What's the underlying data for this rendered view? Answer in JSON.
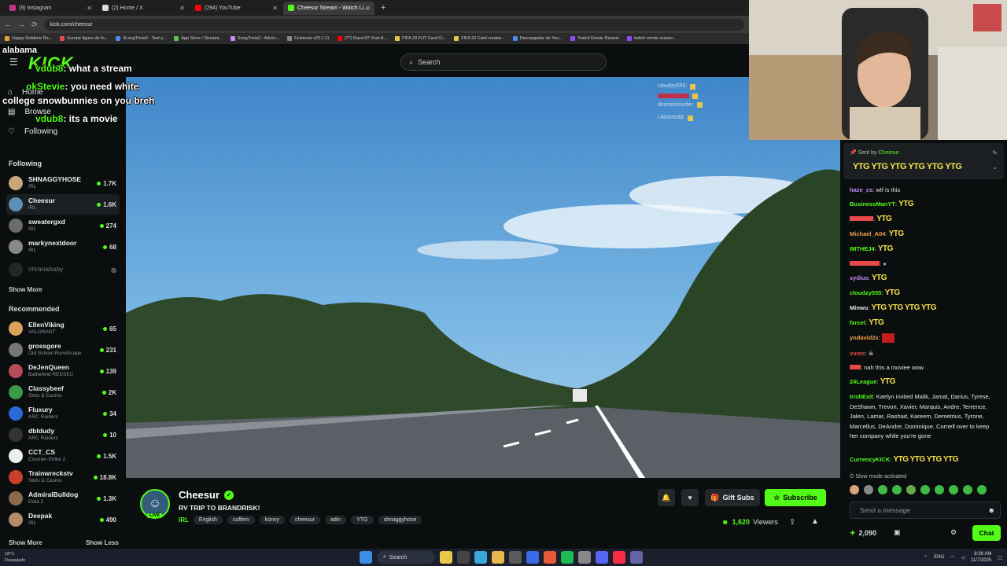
{
  "browser": {
    "tabs": [
      {
        "label": "(9) Instagram",
        "color": "#c13584",
        "active": false
      },
      {
        "label": "(2) Home / X",
        "color": "#dddddd",
        "active": false
      },
      {
        "label": "(294) YouTube",
        "color": "#ff0000",
        "active": false
      },
      {
        "label": "Cheesur Stream - Watch Li...",
        "color": "#53fc18",
        "active": true
      }
    ],
    "url": "kick.com/cheesur",
    "bookmarks": [
      "Happy Goldene Re...",
      "Europe ligues de fo...",
      "4LongTrivia2 - Test y...",
      "App Store / Streami...",
      "SongTrivia2 - Adivin...",
      "Feletools v25.1.11",
      "(77) Razor97 Zest-A...",
      "FIFA 23 FUT Card Cr...",
      "FIFA 23 Card creator...",
      "Descargador de You...",
      "Twitch Emote Resizer",
      "twitch emote resizer..."
    ]
  },
  "kick": {
    "logo": "KICK",
    "search_placeholder": "Search"
  },
  "overlay_chat": [
    {
      "user": "",
      "text": "alabama"
    },
    {
      "user": "vdub8",
      "text": ": what a stream"
    },
    {
      "user": "okStevie",
      "text": ": you need white"
    },
    {
      "user": "",
      "text": "college snowbunnies on you breh"
    },
    {
      "user": "vdub8",
      "text": ": its a movie"
    }
  ],
  "sidebar": {
    "nav": {
      "home": "Home",
      "browse": "Browse",
      "following": "Following"
    },
    "following_title": "Following",
    "following": [
      {
        "name": "SHNAGGYHOSE",
        "category": "IRL",
        "viewers": "1.7K",
        "color": "#c9a57a"
      },
      {
        "name": "Cheesur",
        "category": "IRL",
        "viewers": "1.6K",
        "color": "#5d8fb8"
      },
      {
        "name": "sweatergxd",
        "category": "IRL",
        "viewers": "274",
        "color": "#6b6b6b"
      },
      {
        "name": "markynextdoor",
        "category": "IRL",
        "viewers": "68",
        "color": "#888888"
      },
      {
        "name": "chranababy",
        "category": "",
        "viewers": "",
        "color": "#444444"
      }
    ],
    "show_more": "Show More",
    "recommended_title": "Recommended",
    "recommended": [
      {
        "name": "EllenViking",
        "category": "VALORANT",
        "viewers": "65",
        "color": "#d9a45a"
      },
      {
        "name": "grossgore",
        "category": "Old School RuneScape",
        "viewers": "231",
        "color": "#777777"
      },
      {
        "name": "DeJenQueen",
        "category": "Battlefield REDSEC",
        "viewers": "139",
        "color": "#b84a5a"
      },
      {
        "name": "Classybeef",
        "category": "Slots & Casino",
        "viewers": "2K",
        "color": "#3a9a4a"
      },
      {
        "name": "Fluxury",
        "category": "ARC Raiders",
        "viewers": "34",
        "color": "#2a6ad8"
      },
      {
        "name": "dbldudy",
        "category": "ARC Raiders",
        "viewers": "10",
        "color": "#333333"
      },
      {
        "name": "CCT_CS",
        "category": "Counter-Strike 2",
        "viewers": "1.5K",
        "color": "#eeeeee"
      },
      {
        "name": "Trainwreckstv",
        "category": "Slots & Casino",
        "viewers": "18.8K",
        "color": "#c8402a"
      },
      {
        "name": "AdmiralBulldog",
        "category": "Dota 2",
        "viewers": "1.3K",
        "color": "#8a6a4a"
      },
      {
        "name": "Deepak",
        "category": "IRL",
        "viewers": "490",
        "color": "#b58a6a"
      }
    ],
    "show_more_bottom": "Show More",
    "show_less": "Show Less"
  },
  "video_overlay_names": [
    "cloudzy555:",
    "",
    "demishimvrbn:",
    "I Abortedd:"
  ],
  "stream": {
    "streamer": "Cheesur",
    "live_label": "LIVE",
    "title": "RV TRIP TO BRANDRISK!",
    "category": "IRL",
    "tags": [
      "English",
      "cuffem",
      "konvy",
      "cheesur",
      "adin",
      "YTG",
      "shnaggyhose"
    ],
    "gift_subs": "Gift Subs",
    "subscribe": "Subscribe",
    "viewers": "1,620",
    "viewers_label": "Viewers"
  },
  "chat": {
    "pinned_label": "Sent by",
    "pinned_user": "Cheesur",
    "pinned_message": "YTG YTG YTG YTG YTG YTG",
    "messages": [
      {
        "user": "haze_cs",
        "color": "#c98bf7",
        "text": ": wtf is this",
        "emote": ""
      },
      {
        "user": "BusinessManYT",
        "color": "#53fc18",
        "text": ":",
        "emote": "YTG"
      },
      {
        "user": "",
        "color": "#e84a4a",
        "text": ":",
        "emote": "YTG"
      },
      {
        "user": "Michael_A04",
        "color": "#f0a04a",
        "text": ":",
        "emote": "YTG"
      },
      {
        "user": "IMTHEJ4",
        "color": "#53fc18",
        "text": ":",
        "emote": "YTG"
      },
      {
        "user": "",
        "color": "#e84a4a",
        "text": ":",
        "emote": ""
      },
      {
        "user": "sydius",
        "color": "#c98bf7",
        "text": ":",
        "emote": "YTG"
      },
      {
        "user": "cloudzy555",
        "color": "#53fc18",
        "text": ":",
        "emote": "YTG"
      },
      {
        "user": "Minwu",
        "color": "#e8e8e8",
        "text": ":",
        "emote": "YTG YTG YTG YTG"
      },
      {
        "user": "fxrcel",
        "color": "#53fc18",
        "text": ":",
        "emote": "YTG"
      },
      {
        "user": "yndavid2x",
        "color": "#f0a04a",
        "text": ":",
        "emote": ""
      },
      {
        "user": "vums",
        "color": "#e84a4a",
        "text": ":",
        "emote": ""
      },
      {
        "user": "",
        "color": "#e84a4a",
        "text": ": nah this a moviee wow",
        "emote": ""
      },
      {
        "user": "24League",
        "color": "#53fc18",
        "text": ":",
        "emote": "YTG"
      },
      {
        "user": "IrishExit",
        "color": "#53fc18",
        "text": ": Kaelyn invited Malik, Jamal, Darius, Tyrese, DeShawn, Trevon, Xavier, Marquis, Andre, Terrence, Jalen, Lamar, Rashad, Kareem, Demetrius, Tyrone, Marcellus, DeAndre, Dominique, Cornell over to keep her company while you're gone",
        "emote": ""
      },
      {
        "user": "CurrencyKICK",
        "color": "#53fc18",
        "text": ":",
        "emote": "YTG YTG YTG YTG"
      }
    ],
    "slow_mode": "Slow mode activated",
    "input_placeholder": "Send a message",
    "points": "2,090",
    "chat_button": "Chat"
  },
  "taskbar": {
    "weather_temp": "18°C",
    "weather_desc": "Despejado",
    "search": "Search",
    "lang": "ENG",
    "time": "8:08 AM",
    "date": "11/7/2025"
  }
}
